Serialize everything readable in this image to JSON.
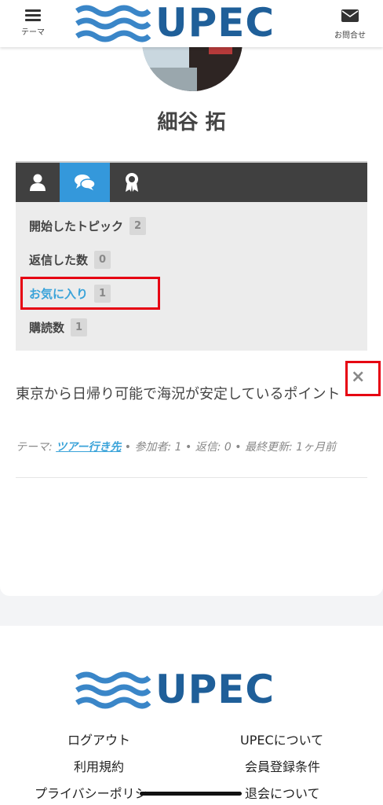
{
  "header": {
    "menu_label": "テーマ",
    "logo_text": "UPEC",
    "contact_label": "お問合せ",
    "brand_color": "#1f5f99"
  },
  "profile": {
    "name": "細谷 拓"
  },
  "tabs": [
    {
      "icon": "user-icon",
      "active": false
    },
    {
      "icon": "chat-bubbles-icon",
      "active": true
    },
    {
      "icon": "award-ribbon-icon",
      "active": false
    }
  ],
  "menu": [
    {
      "label": "開始したトピック",
      "count": "2",
      "active": false
    },
    {
      "label": "返信した数",
      "count": "0",
      "active": false
    },
    {
      "label": "お気に入り",
      "count": "1",
      "active": true
    },
    {
      "label": "購読数",
      "count": "1",
      "active": false
    }
  ],
  "topic": {
    "title": "東京から日帰り可能で海況が安定しているポイント",
    "remove_icon": "×",
    "theme_label": "テーマ:",
    "theme_link": "ツアー行き先",
    "participants": "参加者: 1",
    "replies": "返信: 0",
    "last_updated": "最終更新: 1ヶ月前"
  },
  "footer": {
    "logo_text": "UPEC",
    "links": {
      "logout": "ログアウト",
      "about": "UPECについて",
      "terms": "利用規約",
      "membership": "会員登録条件",
      "privacy": "プライバシーポリシー",
      "withdraw": "退会について"
    }
  },
  "colors": {
    "accent": "#3498db",
    "link": "#3aa3d9",
    "highlight_box": "#e60012",
    "tab_bar": "#404040"
  }
}
